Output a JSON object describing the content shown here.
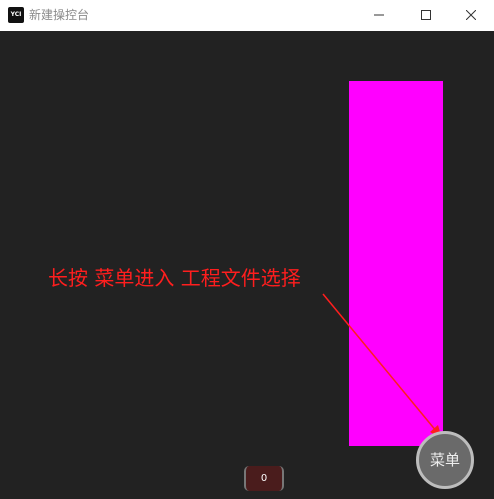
{
  "window": {
    "title": "新建操控台",
    "app_icon_text": "YCI"
  },
  "colors": {
    "background": "#222222",
    "titlebar": "#ffffff",
    "block": "#ff00ff",
    "annotation": "#ff1e1e"
  },
  "controls": {
    "minimize_icon": "minimize-icon",
    "maximize_icon": "maximize-icon",
    "close_icon": "close-icon"
  },
  "annotation": {
    "text": "长按 菜单进入 工程文件选择"
  },
  "menu_button": {
    "label": "菜单"
  },
  "counter": {
    "value": "0"
  }
}
